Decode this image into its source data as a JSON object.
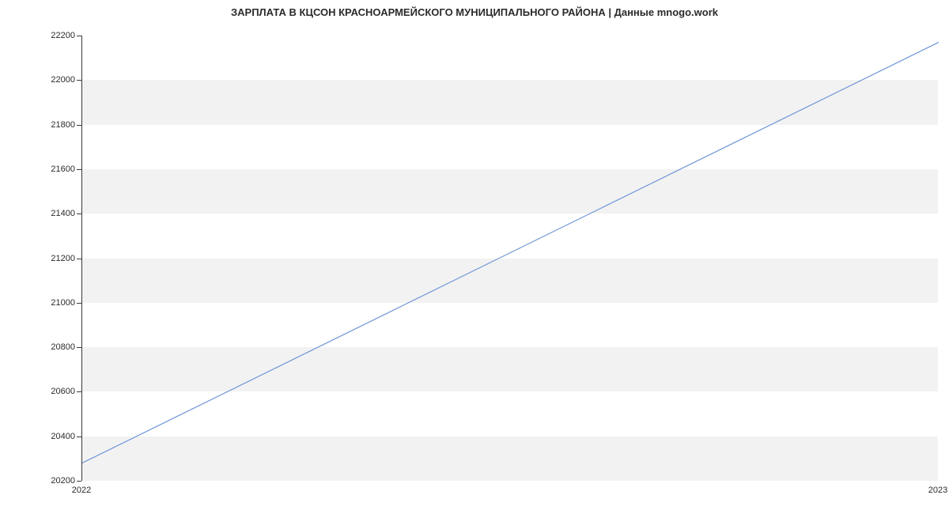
{
  "chart_data": {
    "type": "line",
    "title": "ЗАРПЛАТА В КЦСОН КРАСНОАРМЕЙСКОГО МУНИЦИПАЛЬНОГО РАЙОНА | Данные mnogo.work",
    "xlabel": "",
    "ylabel": "",
    "x": [
      "2022",
      "2023"
    ],
    "x_numeric": [
      2022,
      2023
    ],
    "values": [
      20280,
      22170
    ],
    "ylim": [
      20200,
      22200
    ],
    "xlim": [
      2022,
      2023
    ],
    "y_ticks": [
      20200,
      20400,
      20600,
      20800,
      21000,
      21200,
      21400,
      21600,
      21800,
      22000,
      22200
    ],
    "x_ticks": [
      "2022",
      "2023"
    ],
    "colors": {
      "line": "#6f97d8",
      "band": "#f2f2f2"
    }
  }
}
